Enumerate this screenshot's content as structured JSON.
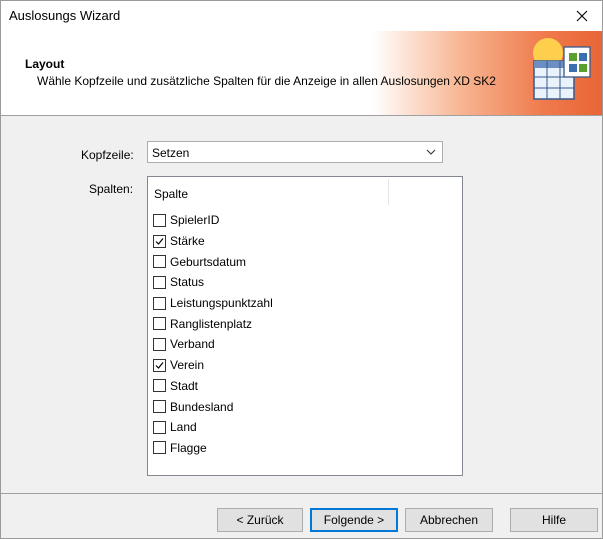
{
  "window": {
    "title": "Auslosungs Wizard",
    "close_glyph": "×"
  },
  "header": {
    "title": "Layout",
    "description": "Wähle Kopfzeile und zusätzliche Spalten für die Anzeige in allen Auslosungen XD SK2",
    "accent_color": "#e86536",
    "icon": "wizard-table-icon"
  },
  "kopfzeile": {
    "label": "Kopfzeile:",
    "value": "Setzen"
  },
  "spalten": {
    "label": "Spalten:",
    "column_header": "Spalte",
    "items": [
      {
        "label": "SpielerID",
        "checked": false
      },
      {
        "label": "Stärke",
        "checked": true
      },
      {
        "label": "Geburtsdatum",
        "checked": false
      },
      {
        "label": "Status",
        "checked": false
      },
      {
        "label": "Leistungspunktzahl",
        "checked": false
      },
      {
        "label": "Ranglistenplatz",
        "checked": false
      },
      {
        "label": "Verband",
        "checked": false
      },
      {
        "label": "Verein",
        "checked": true
      },
      {
        "label": "Stadt",
        "checked": false
      },
      {
        "label": "Bundesland",
        "checked": false
      },
      {
        "label": "Land",
        "checked": false
      },
      {
        "label": "Flagge",
        "checked": false
      }
    ]
  },
  "buttons": {
    "back": "< Zurück",
    "next": "Folgende >",
    "cancel": "Abbrechen",
    "help": "Hilfe"
  }
}
